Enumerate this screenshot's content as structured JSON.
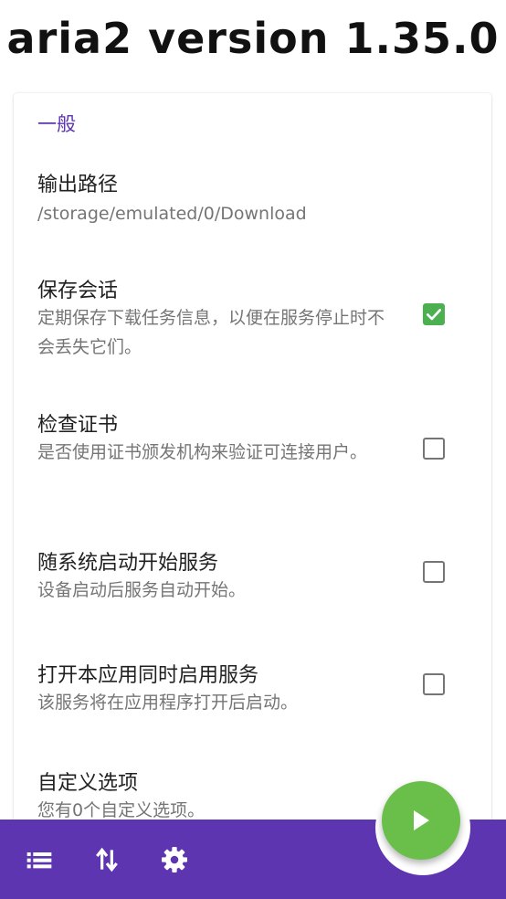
{
  "header": {
    "title": "aria2 version 1.35.0"
  },
  "section": {
    "title": "一般"
  },
  "preferences": [
    {
      "title": "输出路径",
      "summary": "/storage/emulated/0/Download"
    },
    {
      "title": "保存会话",
      "summary": "定期保存下载任务信息，以便在服务停止时不会丢失它们。",
      "checked": true
    },
    {
      "title": "检查证书",
      "summary": "是否使用证书颁发机构来验证可连接用户。",
      "checked": false
    },
    {
      "title": "随系统启动开始服务",
      "summary": "设备启动后服务自动开始。",
      "checked": false
    },
    {
      "title": "打开本应用同时启用服务",
      "summary": "该服务将在应用程序打开后启动。",
      "checked": false
    },
    {
      "title": "自定义选项",
      "summary": "您有0个自定义选项。"
    }
  ],
  "bottom_nav": {
    "icons": [
      "list-icon",
      "swap-vertical-icon",
      "settings-gear-icon"
    ],
    "fab_icon": "play-icon"
  },
  "colors": {
    "accent": "#5e35b1",
    "check": "#4caf50",
    "fab": "#6abf4b"
  }
}
